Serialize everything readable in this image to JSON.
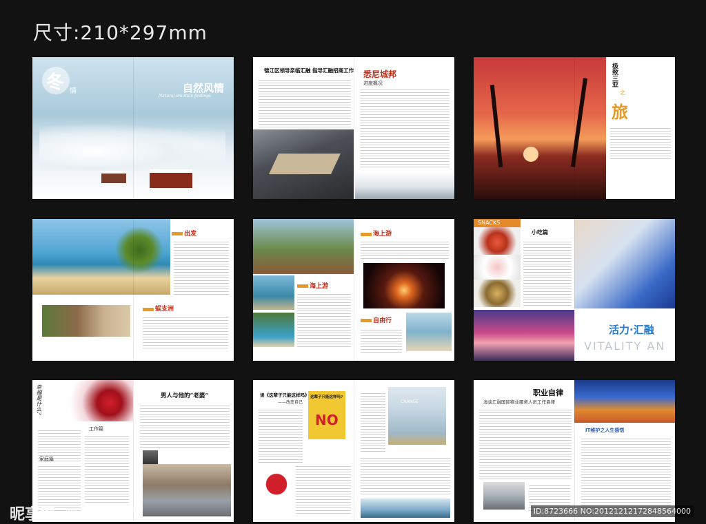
{
  "header": {
    "size_label": "尺寸:210*297mm"
  },
  "spreads": {
    "s1": {
      "big_char": "冬",
      "small_char": "情",
      "title": "自然风情",
      "subtitle": "Natural emotion feelings"
    },
    "s2": {
      "headline": "锦江区领导亲临汇融  指导汇融招商工作",
      "right_title": "悉尼城邦",
      "right_subtitle": "进度概况"
    },
    "s3": {
      "title_part1": "极致三亚",
      "title_part2": "之",
      "title_big": "旅"
    },
    "s4": {
      "label1": "出发",
      "label2": "蜈支洲"
    },
    "s5": {
      "label1": "海上游",
      "label2": "海上游",
      "label3": "自由行"
    },
    "s6": {
      "small_label": "小吃篇",
      "snack_tag": "SNACKS",
      "headline": "活力·汇融",
      "latin": "VITALITY AN"
    },
    "s7": {
      "handwriting": "幸福是什么?",
      "headline": "男人与他的“老婆”",
      "sub1": "工作篇",
      "sub2": "家庭篇"
    },
    "s8": {
      "headline": "读《这辈子只能这样吗》有感",
      "sub": "——改变自己",
      "book_title": "这辈子只能这样吗?",
      "book_no": "NO",
      "change": "CHANGE"
    },
    "s9": {
      "headline": "职业自律",
      "sub": "浅谈汇融国际物业服务人员工作自律",
      "section": "IT维护之人生感悟"
    }
  },
  "watermark": {
    "site": "昵享网",
    "url": "www.nipic.com",
    "id": "ID:8723666 NO:20121212172848564000"
  },
  "colors": {
    "background": "#121212",
    "accent_orange": "#e59a2a",
    "accent_red": "#c4301c"
  }
}
